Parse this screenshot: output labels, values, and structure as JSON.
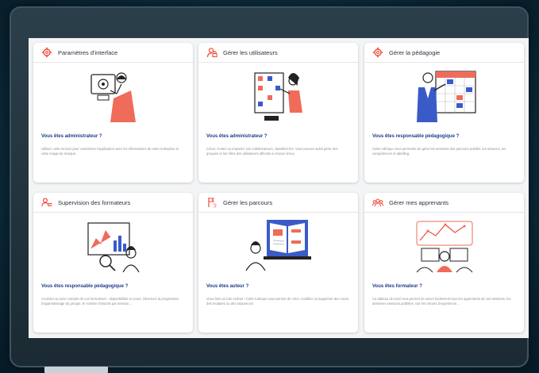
{
  "colors": {
    "accent": "#ef4b3c",
    "navy": "#1d3b8a",
    "illustration_blue": "#3a5bc7"
  },
  "cards": [
    {
      "title": "Paramètres d'interface",
      "icon": "gear-icon",
      "question": "Vous êtes administrateur ?",
      "description": "Utilisez cette section pour customiser l'application avec les informations de votre entreprise et votre image de marque."
    },
    {
      "title": "Gérer les utilisateurs",
      "icon": "user-lock-icon",
      "question": "Vous êtes administrateur ?",
      "description": "Créez, invitez ou importez vos collaborateurs, classifiez-les. Vous pouvez aussi gérer des groupes et les rôles des utilisateurs affectés à chacun d'eux."
    },
    {
      "title": "Gérer la pédagogie",
      "icon": "gear-icon",
      "question": "Vous êtes responsable pédagogique ?",
      "description": "Cette rubrique vous permettra de gérer les sessions des parcours publiés, les séances, les compétences et labelling."
    },
    {
      "title": "Supervision des formateurs",
      "icon": "users-icon",
      "question": "Vous êtes responsable pédagogique ?",
      "description": "Accédez au suivi complet de vos formateurs : disponibilités et cours. Observez la progression d'apprentissage du groupe, le nombre d'inscrits par session..."
    },
    {
      "title": "Gérer les parcours",
      "icon": "route-icon",
      "question": "Vous êtes auteur ?",
      "description": "Vous êtes au bon endroit ! Cette rubrique vous permet de créer, modifier ou supprimer des cours, des modules ou des séquences."
    },
    {
      "title": "Gérer mes apprenants",
      "icon": "group-icon",
      "question": "Vous êtes formateur ?",
      "description": "Ce tableau de bord vous permet de suivre facilement tous les apprenants de vos sessions, les dernières sessions publiées, voir les retours d'expérience..."
    }
  ]
}
